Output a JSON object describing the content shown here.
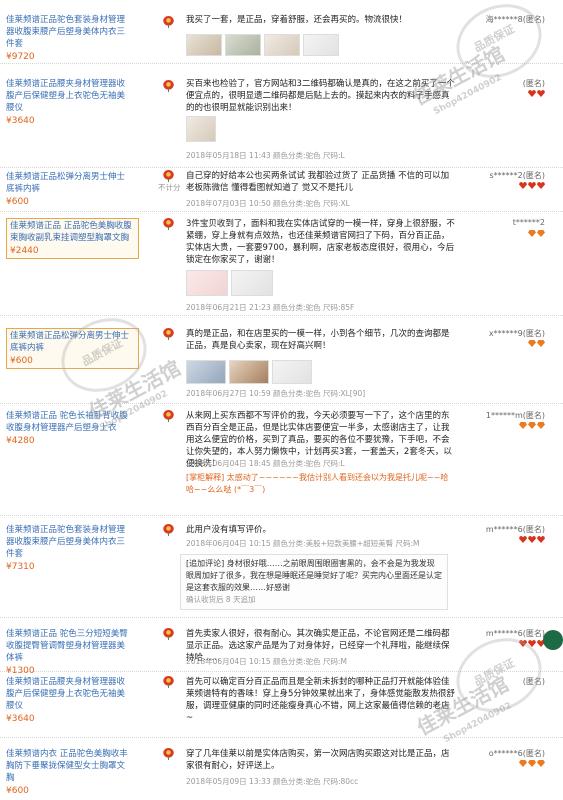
{
  "reviews": [
    {
      "product": "佳莱频谱正品驼色套装身材管理器收腹束腰产后塑身美体内衣三件套",
      "price": "¥9720",
      "text": "我买了一套，是正品，穿着舒服，还会再买的。物流很快！",
      "user": "海******8(匿名)",
      "has_photos": true
    },
    {
      "product": "佳莱频谱正品腰夹身材管理器收腹产后保健塑身上衣驼色无袖美腰仪",
      "price": "¥3640",
      "text": "买百来也检验了，官方网站和3二维码都确认是真的，在这之前买了一个便宜点的，很明显遗二维码都是后贴上去的。摸起来内衣的料子手感真的的也很明显就能识别出来！",
      "meta": "2018年05月18日 11:43 颜色分类:驼色   尺码:L",
      "user": "(匿名)"
    },
    {
      "product": "佳莱频谱正品松弹分离男士伸士底裤内裤",
      "price": "¥600",
      "noscore": "不计分",
      "text": "自己穿的好给本公也买两条试试 我都验过货了 正品货播 不信的可以加老板陈微信 懂得看图就知道了 觉又不是托儿",
      "meta": "2018年07月03日 10:50 颜色分类:驼色   尺码:XL",
      "user": "s******2(匿名)"
    },
    {
      "product": "佳莱频谱正品 正品驼色美胸收腹束胸收副乳束挂调塑型胸罩文胸",
      "price": "¥2440",
      "text": "3件宝贝收到了，面料和我在实体店试穿的一模一样，穿身上很舒服，不紧绷，穿上身就有点效热，也还佳莱频谱官网扫了下码，百分百正品，实体店大贵，一套要9700，暴利啊，店家老板态度很好，很用心，今后锁定在你家买了，谢谢！",
      "meta": "2018年06月21日 21:23 颜色分类:驼色   尺码:85F",
      "user": "t******2",
      "has_photos": true
    },
    {
      "product": "佳莱频谱正品松弹分离男士伸士底裤内裤",
      "price": "¥600",
      "text": "真的是正品，和在店里买的一模一样，小到各个细节，几次的查询都是正品，真是良心卖家，现在好高兴啊！",
      "meta": "2018年06月27日 10:59 颜色分类:驼色   尺码:XL[90]",
      "user": "x******9(匿名)",
      "has_photos": true
    },
    {
      "product": "佳莱频谱正品 驼色长袖卧背收腹收腹身材管理器产后塑身上衣",
      "price": "¥4280",
      "text": "从来网上买东西都不写评价的我，今天必须要写一下了，这个店里的东西百分百全是正品，但是比实体店要便宜一半多，太感谢店主了，让我用这么便宜的价格，买到了真品，要买的各位不要犹豫，下手吧，不会让你失望的，本人努力懒恢中，计划再买3套，一套盖天，2套冬天，以便换洗！",
      "meta": "2018年06月04日 18:45 颜色分类:驼色   尺码:L",
      "reply": "[掌柜解释] 太感动了~~~~~~我估计别人看到还会以为我是托儿呢~~哈哈~~么么哒 (*￣3￣)",
      "user": "1******m(匿名)"
    },
    {
      "product": "佳莱频谱正品驼色套装身材管理器收腹束腰产后塑身美体内衣三件套",
      "price": "¥7310",
      "text": "此用户没有填写评价。",
      "meta": "2018年06月04日 10:15 颜色分类:美股+短款美腰+超短美臀   尺码:M",
      "followup": "[追加评论] 身材很好哦……之前眼周围眼圈害黑的，会不会是为我发现眼周加好了很多，我在想是睡眠还是睡觉好了呢？买完内心里面还是认定是这套衣服的效果……好感谢",
      "followup_meta": "确认收货后 8 天追加",
      "user": "m******6(匿名)"
    },
    {
      "product": "佳莱频谱正品 驼色三分短短美臀收腹提臀管调臀塑身材管理器美体裤",
      "price": "¥1300",
      "text": "首先卖家人很好，很有耐心。其次确实是正品，不论官网还是二维码都显示正品。选这家产品是为了对身体好，已经穿一个礼拜啦，能继续保持哈……",
      "meta": "2018年06月04日 10:15 颜色分类:驼色   尺码:M",
      "user": "m******6(匿名)"
    },
    {
      "product": "佳莱频谱正品腰夹身材管理器收腹产后保健塑身上衣驼色无袖美腰仪",
      "price": "¥3640",
      "text": "首先可以确定百分百正品而且是全新未拆封的哪种正品打开就能体验佳莱频谱特有的香味！穿上身5分钟效果就出来了，身体感觉能散发热很舒服，调理亚健康的同时还能瘦身真心不错，网上这家最值得信赖的老店~",
      "user": "(匿名)"
    },
    {
      "product": "佳莱频谱内衣 正品驼色美胸收丰胸防下垂聚拢保健型女士胸罩文胸",
      "price": "¥600",
      "text": "穿了几年佳莱以前是实体店购买，第一次网店购买跟这对比是正品，店家很有耐心，好评送上。",
      "meta": "2018年05月09日 13:33 颜色分类:驼色   尺码:80cc",
      "user": "o******6(匿名)"
    }
  ],
  "watermark": {
    "main_text": "佳莱生活馆",
    "sub_text": "Shop42040902",
    "stamp_text": "品质保证"
  },
  "colors": {
    "link": "#3a6fb5",
    "price": "#e0641c",
    "meta": "#999999",
    "heart": "#d8341c"
  }
}
